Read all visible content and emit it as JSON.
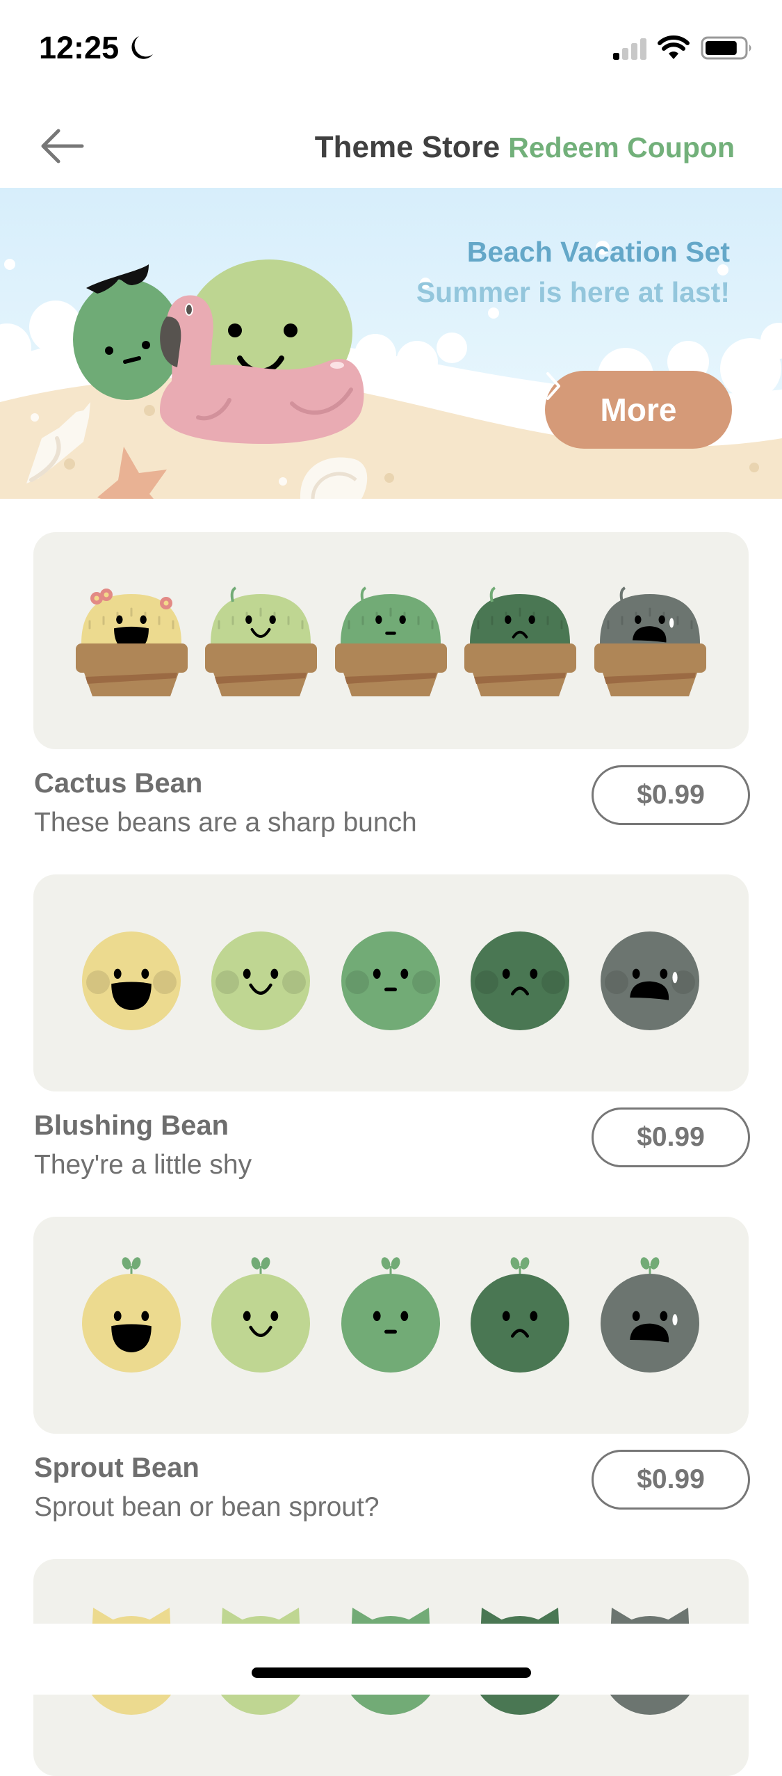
{
  "status_bar": {
    "time": "12:25",
    "focus_icon": "moon-icon",
    "signal_bars_filled": 1,
    "signal_bars_total": 4,
    "battery_level": 0.8
  },
  "header": {
    "back_icon": "arrow-left-icon",
    "title": "Theme Store",
    "redeem_label": "Redeem Coupon",
    "accent_color": "#72b07a"
  },
  "banner": {
    "title": "Beach Vacation Set",
    "subtitle": "Summer is here at last!",
    "button_label": "More",
    "button_icon": "chevron-right-icon",
    "button_color": "#d59a78"
  },
  "products": [
    {
      "name": "Cactus Bean",
      "description": "These beans are a sharp bunch",
      "price": "$0.99",
      "style": "cactus",
      "moods": [
        "ecstatic",
        "happy",
        "neutral",
        "sad",
        "crying"
      ]
    },
    {
      "name": "Blushing Bean",
      "description": "They're a little shy",
      "price": "$0.99",
      "style": "blush",
      "moods": [
        "ecstatic",
        "happy",
        "neutral",
        "sad",
        "crying"
      ]
    },
    {
      "name": "Sprout Bean",
      "description": "Sprout bean or bean sprout?",
      "price": "$0.99",
      "style": "sprout",
      "moods": [
        "ecstatic",
        "happy",
        "neutral",
        "sad",
        "crying"
      ]
    },
    {
      "style": "cat",
      "moods": [
        "ecstatic",
        "happy",
        "neutral",
        "sad",
        "crying"
      ]
    }
  ],
  "mood_colors": {
    "ecstatic": "#ecda8f",
    "happy": "#bfd692",
    "neutral": "#72ab76",
    "sad": "#4a7753",
    "crying": "#6c7570"
  }
}
